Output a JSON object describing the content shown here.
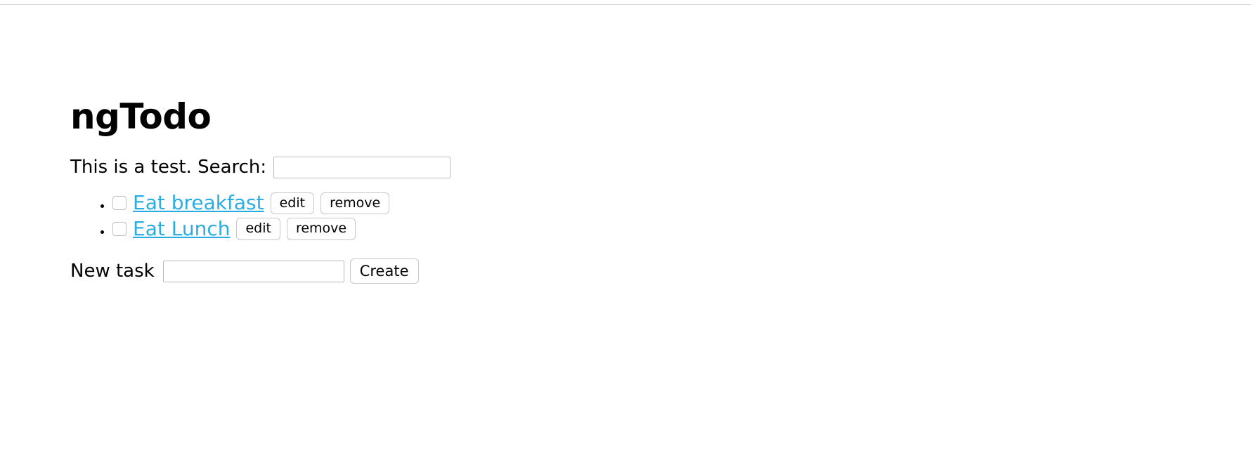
{
  "app": {
    "title": "ngTodo"
  },
  "search": {
    "label": "This is a test. Search:",
    "value": "",
    "placeholder": ""
  },
  "todos": [
    {
      "label": "Eat breakfast",
      "checked": false,
      "edit_label": "edit",
      "remove_label": "remove"
    },
    {
      "label": "Eat Lunch",
      "checked": false,
      "edit_label": "edit",
      "remove_label": "remove"
    }
  ],
  "new_task": {
    "label": "New task",
    "value": "",
    "placeholder": "",
    "create_label": "Create"
  },
  "colors": {
    "link": "#29ade4",
    "text": "#000000",
    "border": "#bcbcbc",
    "button_border": "#c8c8c8",
    "background": "#ffffff"
  }
}
